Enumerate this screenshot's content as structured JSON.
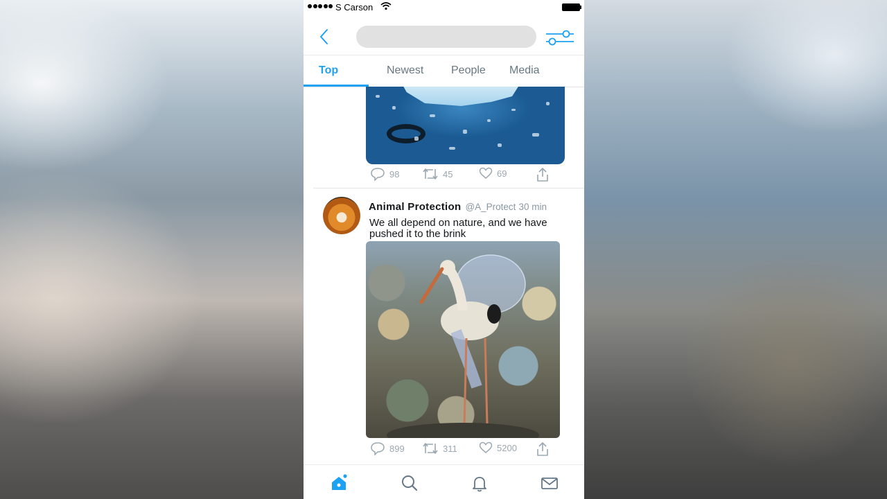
{
  "status_bar": {
    "carrier": "S Carson"
  },
  "tabs": [
    {
      "label": "Top",
      "active": true
    },
    {
      "label": "Newest",
      "active": false
    },
    {
      "label": "People",
      "active": false
    },
    {
      "label": "Media",
      "active": false
    }
  ],
  "tweets": [
    {
      "image_icon": "ocean-plastic-image",
      "replies": "98",
      "retweets": "45",
      "likes": "69"
    },
    {
      "author": "Animal Protection",
      "handle": "@A_Protect",
      "time": "30 min",
      "text": "We all depend on nature, and we have pushed it to the brink",
      "image_icon": "stork-in-plastic-image",
      "replies": "899",
      "retweets": "311",
      "likes": "5200"
    }
  ],
  "bottom_nav": [
    "home-icon",
    "search-icon",
    "notifications-icon",
    "messages-icon"
  ],
  "colors": {
    "accent": "#1da1f2",
    "muted": "#9aa7b0",
    "text": "#14171a"
  }
}
